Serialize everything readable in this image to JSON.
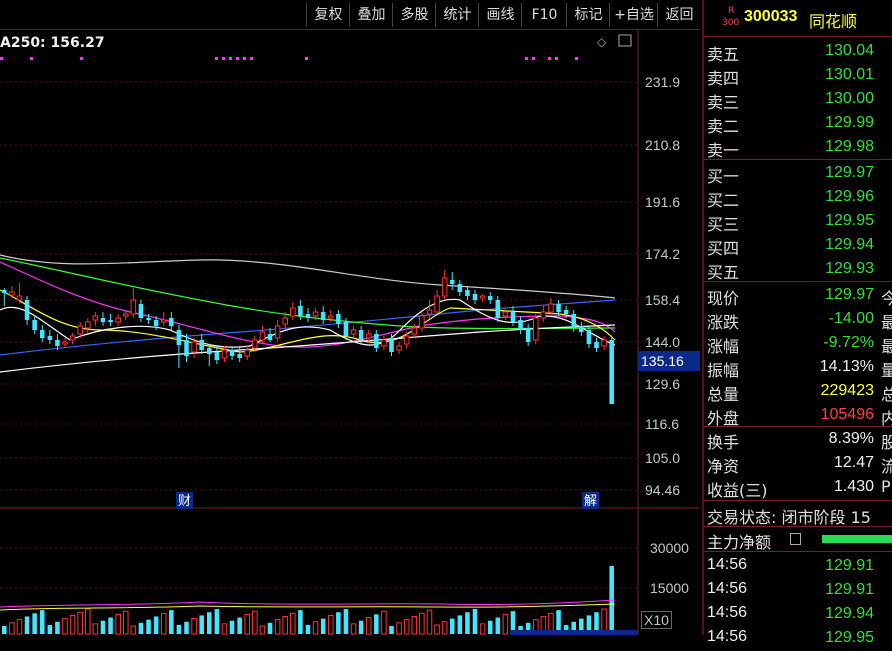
{
  "toolbar": {
    "buttons": [
      "复权",
      "叠加",
      "多股",
      "统计",
      "画线",
      "F10",
      "标记",
      "+自选",
      "返回"
    ]
  },
  "indicator": {
    "ma_label": "A250: 156.27"
  },
  "price_axis": {
    "ticks": [
      "231.9",
      "210.8",
      "191.6",
      "174.2",
      "158.4",
      "144.0",
      "129.6",
      "116.6",
      "105.0",
      "94.46"
    ],
    "current_price_label": "135.16"
  },
  "volume_axis": {
    "ticks": [
      "30000",
      "15000"
    ],
    "unit_label": "X10"
  },
  "event_markers": {
    "cai": "财",
    "jie": "解"
  },
  "stock": {
    "badge_top": "R",
    "badge_bottom": "300",
    "code": "300033",
    "name": "同花顺"
  },
  "order_book": {
    "asks": [
      {
        "label": "卖五",
        "price": "130.04"
      },
      {
        "label": "卖四",
        "price": "130.01"
      },
      {
        "label": "卖三",
        "price": "130.00"
      },
      {
        "label": "卖二",
        "price": "129.99"
      },
      {
        "label": "卖一",
        "price": "129.98"
      }
    ],
    "bids": [
      {
        "label": "买一",
        "price": "129.97"
      },
      {
        "label": "买二",
        "price": "129.96"
      },
      {
        "label": "买三",
        "price": "129.95"
      },
      {
        "label": "买四",
        "price": "129.94"
      },
      {
        "label": "买五",
        "price": "129.93"
      }
    ]
  },
  "quote": [
    {
      "label": "现价",
      "value": "129.97",
      "extra": "今"
    },
    {
      "label": "涨跌",
      "value": "-14.00",
      "extra": "最"
    },
    {
      "label": "涨幅",
      "value": "-9.72%",
      "extra": "最"
    },
    {
      "label": "振幅",
      "value": "14.13%",
      "extra": "量"
    },
    {
      "label": "总量",
      "value": "229423",
      "extra": "总"
    },
    {
      "label": "外盘",
      "value": "105496",
      "extra": "内"
    }
  ],
  "stats": [
    {
      "label": "换手",
      "value": "8.39%",
      "extra": "股"
    },
    {
      "label": "净资",
      "value": "12.47",
      "extra": "流"
    },
    {
      "label": "收益(三)",
      "value": "1.430",
      "extra": "P"
    }
  ],
  "status": {
    "trade_state": "交易状态: 闭市阶段 15"
  },
  "main_force": {
    "label": "主力净额"
  },
  "ticks": [
    {
      "time": "14:56",
      "price": "129.91"
    },
    {
      "time": "14:56",
      "price": "129.91"
    },
    {
      "time": "14:56",
      "price": "129.94"
    },
    {
      "time": "14:56",
      "price": "129.95"
    }
  ],
  "colors": {
    "up": "#ff3333",
    "down": "#44e6ff",
    "ma5": "#ffffff",
    "ma10": "#ffff33",
    "ma20": "#ff33ff",
    "ma60": "#33ff33",
    "ma120": "#3366ff",
    "ma250": "#cccccc"
  },
  "chart_data": {
    "type": "candlestick",
    "candles": [
      [
        290,
        293,
        288,
        306,
        "d"
      ],
      [
        292,
        295,
        286,
        298,
        "u"
      ],
      [
        296,
        300,
        283,
        303,
        "u"
      ],
      [
        300,
        320,
        296,
        325,
        "d"
      ],
      [
        320,
        330,
        315,
        334,
        "d"
      ],
      [
        330,
        338,
        325,
        342,
        "d"
      ],
      [
        336,
        340,
        330,
        344,
        "d"
      ],
      [
        340,
        346,
        334,
        350,
        "d"
      ],
      [
        344,
        342,
        338,
        348,
        "u"
      ],
      [
        340,
        336,
        333,
        344,
        "u"
      ],
      [
        334,
        326,
        322,
        338,
        "u"
      ],
      [
        328,
        322,
        318,
        333,
        "u"
      ],
      [
        320,
        316,
        312,
        326,
        "u"
      ],
      [
        318,
        322,
        312,
        326,
        "d"
      ],
      [
        320,
        322,
        314,
        326,
        "d"
      ],
      [
        322,
        318,
        314,
        326,
        "u"
      ],
      [
        316,
        314,
        310,
        320,
        "u"
      ],
      [
        314,
        300,
        288,
        318,
        "u"
      ],
      [
        304,
        318,
        300,
        322,
        "d"
      ],
      [
        318,
        320,
        314,
        324,
        "d"
      ],
      [
        320,
        326,
        316,
        330,
        "d"
      ],
      [
        322,
        320,
        312,
        326,
        "u"
      ],
      [
        318,
        326,
        312,
        330,
        "d"
      ],
      [
        330,
        345,
        325,
        368,
        "d"
      ],
      [
        340,
        356,
        334,
        362,
        "d"
      ],
      [
        352,
        342,
        338,
        358,
        "u"
      ],
      [
        340,
        350,
        334,
        354,
        "d"
      ],
      [
        348,
        354,
        344,
        366,
        "d"
      ],
      [
        352,
        360,
        346,
        364,
        "d"
      ],
      [
        358,
        350,
        346,
        362,
        "u"
      ],
      [
        350,
        356,
        346,
        360,
        "d"
      ],
      [
        354,
        358,
        346,
        362,
        "d"
      ],
      [
        356,
        350,
        346,
        360,
        "u"
      ],
      [
        348,
        340,
        336,
        352,
        "u"
      ],
      [
        340,
        332,
        326,
        344,
        "u"
      ],
      [
        334,
        340,
        328,
        342,
        "d"
      ],
      [
        338,
        326,
        320,
        342,
        "u"
      ],
      [
        324,
        318,
        312,
        330,
        "u"
      ],
      [
        316,
        308,
        302,
        320,
        "u"
      ],
      [
        306,
        316,
        300,
        320,
        "d"
      ],
      [
        314,
        318,
        308,
        322,
        "d"
      ],
      [
        316,
        312,
        308,
        320,
        "u"
      ],
      [
        312,
        320,
        306,
        324,
        "d"
      ],
      [
        318,
        316,
        310,
        322,
        "u"
      ],
      [
        314,
        324,
        310,
        328,
        "d"
      ],
      [
        322,
        336,
        318,
        340,
        "d"
      ],
      [
        334,
        330,
        326,
        338,
        "u"
      ],
      [
        330,
        340,
        326,
        344,
        "d"
      ],
      [
        338,
        334,
        330,
        342,
        "u"
      ],
      [
        334,
        348,
        330,
        352,
        "d"
      ],
      [
        346,
        340,
        336,
        350,
        "u"
      ],
      [
        338,
        352,
        334,
        356,
        "d"
      ],
      [
        350,
        346,
        342,
        354,
        "u"
      ],
      [
        344,
        336,
        332,
        348,
        "u"
      ],
      [
        334,
        328,
        324,
        338,
        "u"
      ],
      [
        328,
        316,
        312,
        332,
        "u"
      ],
      [
        314,
        310,
        300,
        318,
        "u"
      ],
      [
        312,
        296,
        290,
        314,
        "u"
      ],
      [
        296,
        278,
        270,
        300,
        "u"
      ],
      [
        280,
        284,
        272,
        290,
        "d"
      ],
      [
        284,
        292,
        280,
        296,
        "d"
      ],
      [
        290,
        296,
        286,
        300,
        "d"
      ],
      [
        294,
        300,
        290,
        304,
        "d"
      ],
      [
        298,
        296,
        294,
        302,
        "u"
      ],
      [
        296,
        300,
        292,
        304,
        "d"
      ],
      [
        300,
        318,
        296,
        322,
        "d"
      ],
      [
        316,
        312,
        308,
        320,
        "u"
      ],
      [
        312,
        322,
        306,
        326,
        "d"
      ],
      [
        320,
        330,
        316,
        334,
        "d"
      ],
      [
        328,
        342,
        324,
        346,
        "d"
      ],
      [
        340,
        318,
        314,
        344,
        "u"
      ],
      [
        318,
        312,
        306,
        322,
        "u"
      ],
      [
        312,
        304,
        298,
        316,
        "u"
      ],
      [
        304,
        312,
        300,
        316,
        "d"
      ],
      [
        310,
        314,
        306,
        318,
        "d"
      ],
      [
        314,
        328,
        310,
        332,
        "d"
      ],
      [
        326,
        332,
        322,
        336,
        "d"
      ],
      [
        330,
        344,
        326,
        348,
        "d"
      ],
      [
        342,
        348,
        338,
        352,
        "d"
      ],
      [
        346,
        340,
        336,
        350,
        "u"
      ],
      [
        340,
        404,
        336,
        404,
        "d"
      ]
    ]
  }
}
